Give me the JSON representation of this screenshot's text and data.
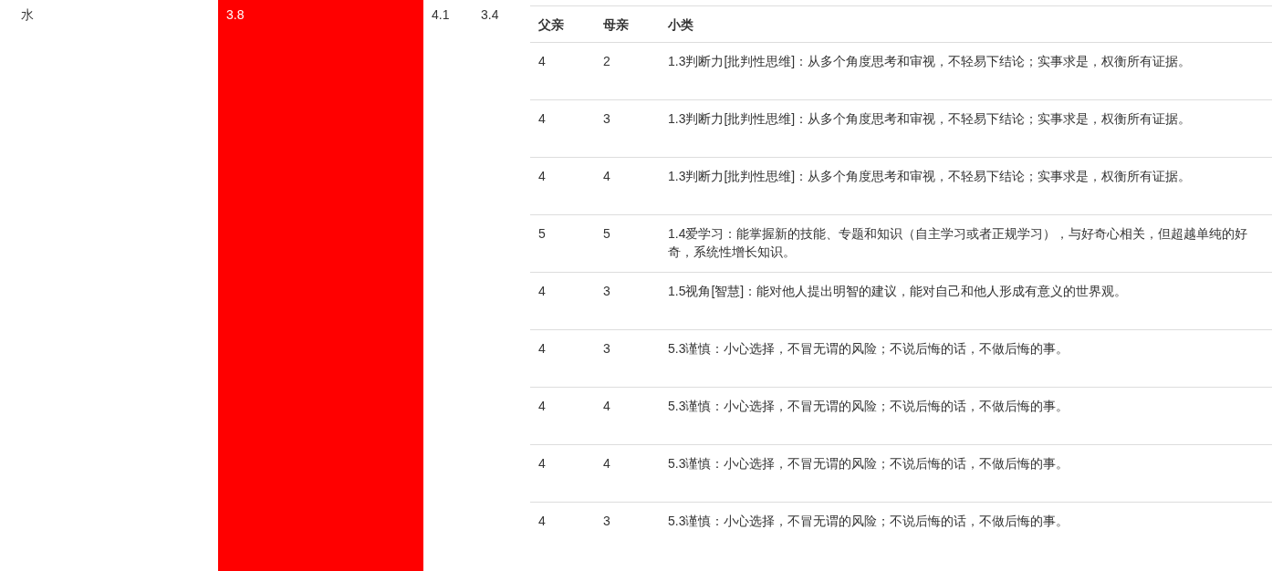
{
  "row": {
    "label": "水",
    "scores": [
      {
        "value": "3.8",
        "highlighted": true
      },
      {
        "value": "4.1",
        "highlighted": false
      },
      {
        "value": "3.4",
        "highlighted": false
      }
    ]
  },
  "detail_table": {
    "columns": [
      "父亲",
      "母亲",
      "小类"
    ],
    "rows": [
      {
        "father": "4",
        "mother": "2",
        "category": "1.3判断力[批判性思维]：从多个角度思考和审视，不轻易下结论；实事求是，权衡所有证据。"
      },
      {
        "father": "4",
        "mother": "3",
        "category": "1.3判断力[批判性思维]：从多个角度思考和审视，不轻易下结论；实事求是，权衡所有证据。"
      },
      {
        "father": "4",
        "mother": "4",
        "category": "1.3判断力[批判性思维]：从多个角度思考和审视，不轻易下结论；实事求是，权衡所有证据。"
      },
      {
        "father": "5",
        "mother": "5",
        "category": "1.4爱学习：能掌握新的技能、专题和知识（自主学习或者正规学习），与好奇心相关，但超越单纯的好奇，系统性增长知识。"
      },
      {
        "father": "4",
        "mother": "3",
        "category": "1.5视角[智慧]：能对他人提出明智的建议，能对自己和他人形成有意义的世界观。"
      },
      {
        "father": "4",
        "mother": "3",
        "category": "5.3谨慎：小心选择，不冒无谓的风险；不说后悔的话，不做后悔的事。"
      },
      {
        "father": "4",
        "mother": "4",
        "category": "5.3谨慎：小心选择，不冒无谓的风险；不说后悔的话，不做后悔的事。"
      },
      {
        "father": "4",
        "mother": "4",
        "category": "5.3谨慎：小心选择，不冒无谓的风险；不说后悔的话，不做后悔的事。"
      },
      {
        "father": "4",
        "mother": "3",
        "category": "5.3谨慎：小心选择，不冒无谓的风险；不说后悔的话，不做后悔的事。"
      }
    ]
  }
}
